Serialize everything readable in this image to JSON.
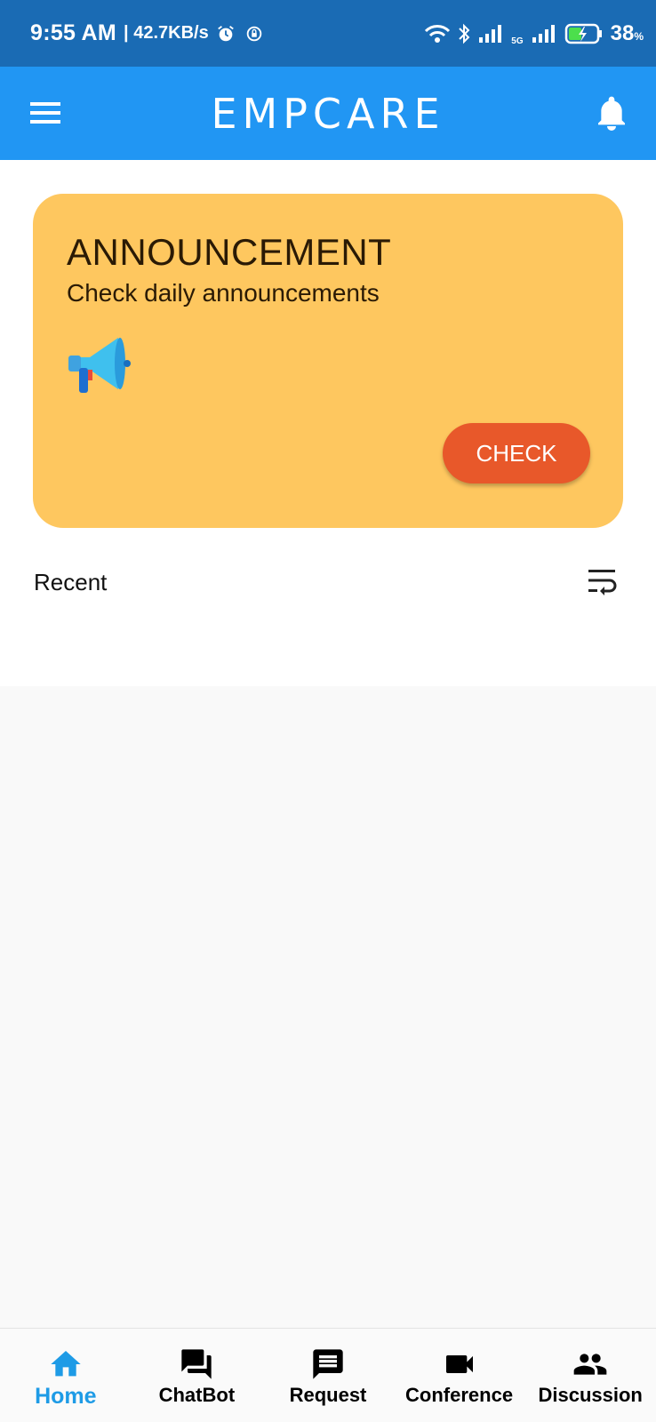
{
  "status_bar": {
    "time": "9:55 AM",
    "speed": "| 42.7KB/s",
    "network_label": "5G",
    "battery": "38",
    "battery_unit": "%"
  },
  "app_bar": {
    "title": "EMPCARE",
    "menu_icon": "hamburger-menu-icon",
    "bell_icon": "notification-bell-icon",
    "color": "#2196f3"
  },
  "announcement": {
    "title": "ANNOUNCEMENT",
    "subtitle": "Check daily announcements",
    "icon": "megaphone-icon",
    "button_label": "CHECK",
    "card_color": "#fec75f",
    "button_color": "#e8582a"
  },
  "recent": {
    "label": "Recent",
    "icon": "wrap-text-icon"
  },
  "bottom_nav": {
    "items": [
      {
        "label": "Home",
        "icon": "home-icon",
        "active": true
      },
      {
        "label": "ChatBot",
        "icon": "forum-icon",
        "active": false
      },
      {
        "label": "Request",
        "icon": "message-icon",
        "active": false
      },
      {
        "label": "Conference",
        "icon": "videocam-icon",
        "active": false
      },
      {
        "label": "Discussion",
        "icon": "people-icon",
        "active": false
      }
    ],
    "active_color": "#1e9be6"
  }
}
